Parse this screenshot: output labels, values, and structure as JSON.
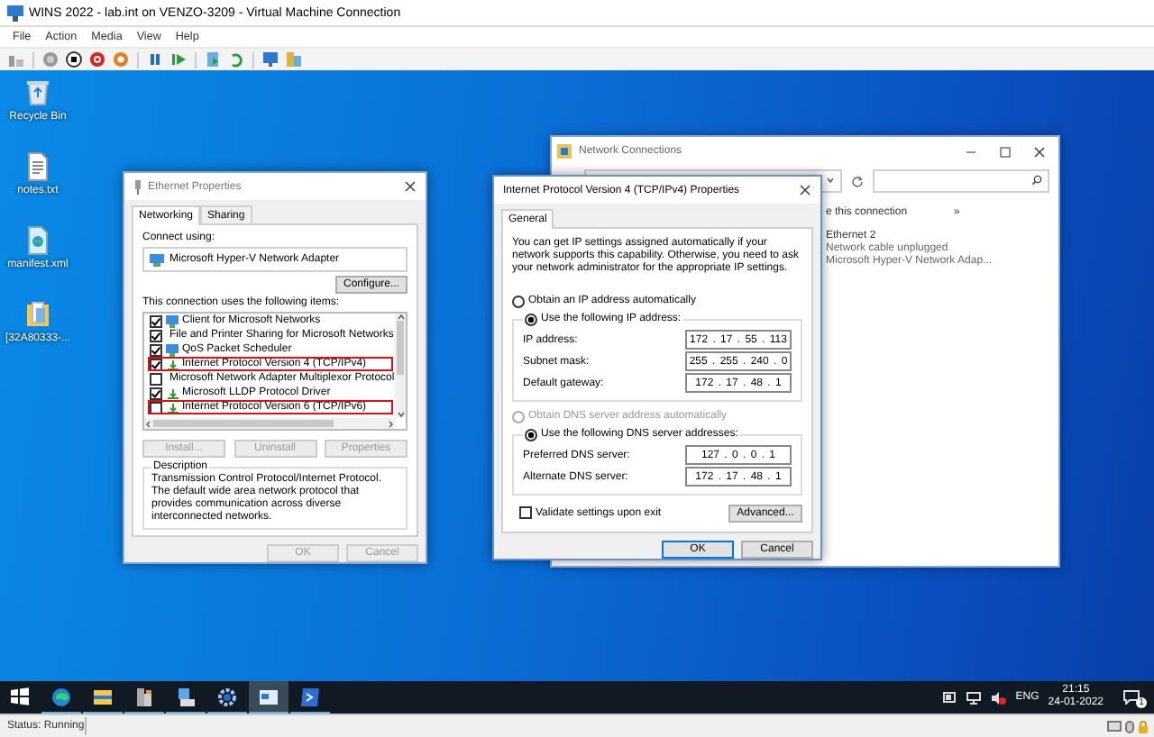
{
  "window": {
    "title": "WINS 2022 - lab.int on VENZO-3209 - Virtual Machine Connection"
  },
  "menu": [
    "File",
    "Action",
    "Media",
    "View",
    "Help"
  ],
  "desktop_icons": [
    {
      "label": "Recycle Bin",
      "kind": "bin"
    },
    {
      "label": "notes.txt",
      "kind": "text"
    },
    {
      "label": "manifest.xml",
      "kind": "xml"
    },
    {
      "label": "[32A80333-...",
      "kind": "folder"
    }
  ],
  "network_connections": {
    "title": "Network Connections",
    "toolbar_text": "e this connection",
    "overflow": "»",
    "item": {
      "name": "Ethernet 2",
      "status": "Network cable unplugged",
      "device": "Microsoft Hyper-V Network Adap..."
    }
  },
  "ethernet_properties": {
    "title": "Ethernet Properties",
    "tabs": [
      {
        "label": "Networking",
        "selected": true
      },
      {
        "label": "Sharing",
        "selected": false
      }
    ],
    "connect_using_label": "Connect using:",
    "adapter": "Microsoft Hyper-V Network Adapter",
    "configure_button": "Configure...",
    "items_label": "This connection uses the following items:",
    "items": [
      {
        "label": "Client for Microsoft Networks",
        "kind": "service",
        "checked": true,
        "highlighted": false
      },
      {
        "label": "File and Printer Sharing for Microsoft Networks",
        "kind": "service",
        "checked": true,
        "highlighted": false
      },
      {
        "label": "QoS Packet Scheduler",
        "kind": "service",
        "checked": true,
        "highlighted": false
      },
      {
        "label": "Internet Protocol Version 4 (TCP/IPv4)",
        "kind": "protocol",
        "checked": true,
        "highlighted": true
      },
      {
        "label": "Microsoft Network Adapter Multiplexor Protocol",
        "kind": "protocol",
        "checked": false,
        "highlighted": false
      },
      {
        "label": "Microsoft LLDP Protocol Driver",
        "kind": "protocol",
        "checked": true,
        "highlighted": false
      },
      {
        "label": "Internet Protocol Version 6 (TCP/IPv6)",
        "kind": "protocol",
        "checked": false,
        "highlighted": true
      }
    ],
    "buttons": [
      {
        "label": "Install...",
        "disabled": true
      },
      {
        "label": "Uninstall",
        "disabled": true
      },
      {
        "label": "Properties",
        "disabled": true
      }
    ],
    "description_title": "Description",
    "description": "Transmission Control Protocol/Internet Protocol. The default wide area network protocol that provides communication across diverse interconnected networks.",
    "dialog_buttons": [
      {
        "label": "OK",
        "disabled": true
      },
      {
        "label": "Cancel",
        "disabled": true
      }
    ]
  },
  "ipv4_properties": {
    "title": "Internet Protocol Version 4 (TCP/IPv4) Properties",
    "tabs": [
      {
        "label": "General",
        "selected": true
      }
    ],
    "intro": "You can get IP settings assigned automatically if your network supports this capability. Otherwise, you need to ask your network administrator for the appropriate IP settings.",
    "ip_options": [
      {
        "label": "Obtain an IP address automatically",
        "selected": false,
        "disabled": false
      },
      {
        "label": "Use the following IP address:",
        "selected": true,
        "disabled": false
      }
    ],
    "ip_fields": [
      {
        "label": "IP address:",
        "value": "172 . 17 . 55 . 113"
      },
      {
        "label": "Subnet mask:",
        "value": "255 . 255 . 240 . 0"
      },
      {
        "label": "Default gateway:",
        "value": "172 . 17 . 48 . 1"
      }
    ],
    "dns_options": [
      {
        "label": "Obtain DNS server address automatically",
        "selected": false,
        "disabled": true
      },
      {
        "label": "Use the following DNS server addresses:",
        "selected": true,
        "disabled": false
      }
    ],
    "dns_fields": [
      {
        "label": "Preferred DNS server:",
        "value": "127 . 0 . 0 . 1"
      },
      {
        "label": "Alternate DNS server:",
        "value": "172 . 17 . 48 . 1"
      }
    ],
    "validate": {
      "label": "Validate settings upon exit",
      "checked": false
    },
    "advanced_button": "Advanced...",
    "buttons": [
      "OK",
      "Cancel"
    ]
  },
  "taskbar": {
    "apps": [
      {
        "kind": "start",
        "selected": false
      },
      {
        "kind": "browser",
        "selected": false
      },
      {
        "kind": "explorer",
        "selected": false
      },
      {
        "kind": "server",
        "selected": false
      },
      {
        "kind": "network",
        "selected": false
      },
      {
        "kind": "settings",
        "selected": false
      },
      {
        "kind": "control",
        "selected": true
      },
      {
        "kind": "shell",
        "selected": false
      }
    ],
    "language": "ENG",
    "time": "21:15",
    "date": "24-01-2022",
    "notifications": "1"
  },
  "status_bar": "Status: Running"
}
